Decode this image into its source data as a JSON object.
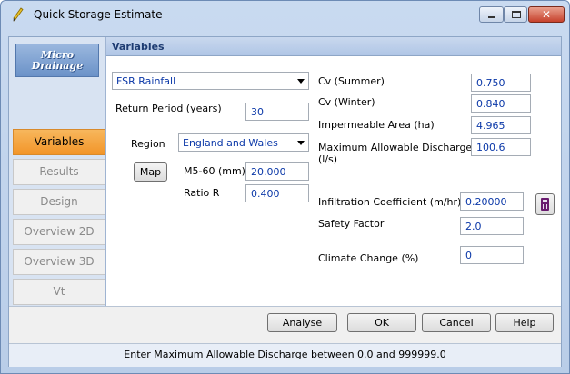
{
  "window": {
    "title": "Quick Storage Estimate",
    "close_glyph": "✕"
  },
  "logo": {
    "line1": "Micro",
    "line2": "Drainage"
  },
  "sidebar": {
    "items": [
      {
        "label": "Variables",
        "active": true
      },
      {
        "label": "Results",
        "active": false
      },
      {
        "label": "Design",
        "active": false
      },
      {
        "label": "Overview 2D",
        "active": false
      },
      {
        "label": "Overview 3D",
        "active": false
      },
      {
        "label": "Vt",
        "active": false
      }
    ]
  },
  "panel": {
    "title": "Variables",
    "rainfall_type": "FSR Rainfall",
    "return_period": {
      "label": "Return Period (years)",
      "value": "30"
    },
    "region": {
      "label": "Region",
      "value": "England and Wales"
    },
    "map_button": "Map",
    "m5_60": {
      "label": "M5-60 (mm)",
      "value": "20.000"
    },
    "ratio_r": {
      "label": "Ratio R",
      "value": "0.400"
    },
    "cv_summer": {
      "label": "Cv (Summer)",
      "value": "0.750"
    },
    "cv_winter": {
      "label": "Cv (Winter)",
      "value": "0.840"
    },
    "impermeable_area": {
      "label": "Impermeable Area (ha)",
      "value": "4.965"
    },
    "max_discharge": {
      "label_line1": "Maximum Allowable Discharge",
      "label_line2": "(l/s)",
      "value": "100.6"
    },
    "infiltration": {
      "label": "Infiltration Coefficient (m/hr)",
      "value": "0.20000"
    },
    "safety_factor": {
      "label": "Safety Factor",
      "value": "2.0"
    },
    "climate_change": {
      "label": "Climate Change (%)",
      "value": "0"
    }
  },
  "buttons": {
    "analyse": "Analyse",
    "ok": "OK",
    "cancel": "Cancel",
    "help": "Help"
  },
  "status_text": "Enter Maximum Allowable Discharge between 0.0 and 999999.0",
  "colors": {
    "accent": "#f29529",
    "value_text": "#0b38a8",
    "header_text": "#1e3c72"
  }
}
